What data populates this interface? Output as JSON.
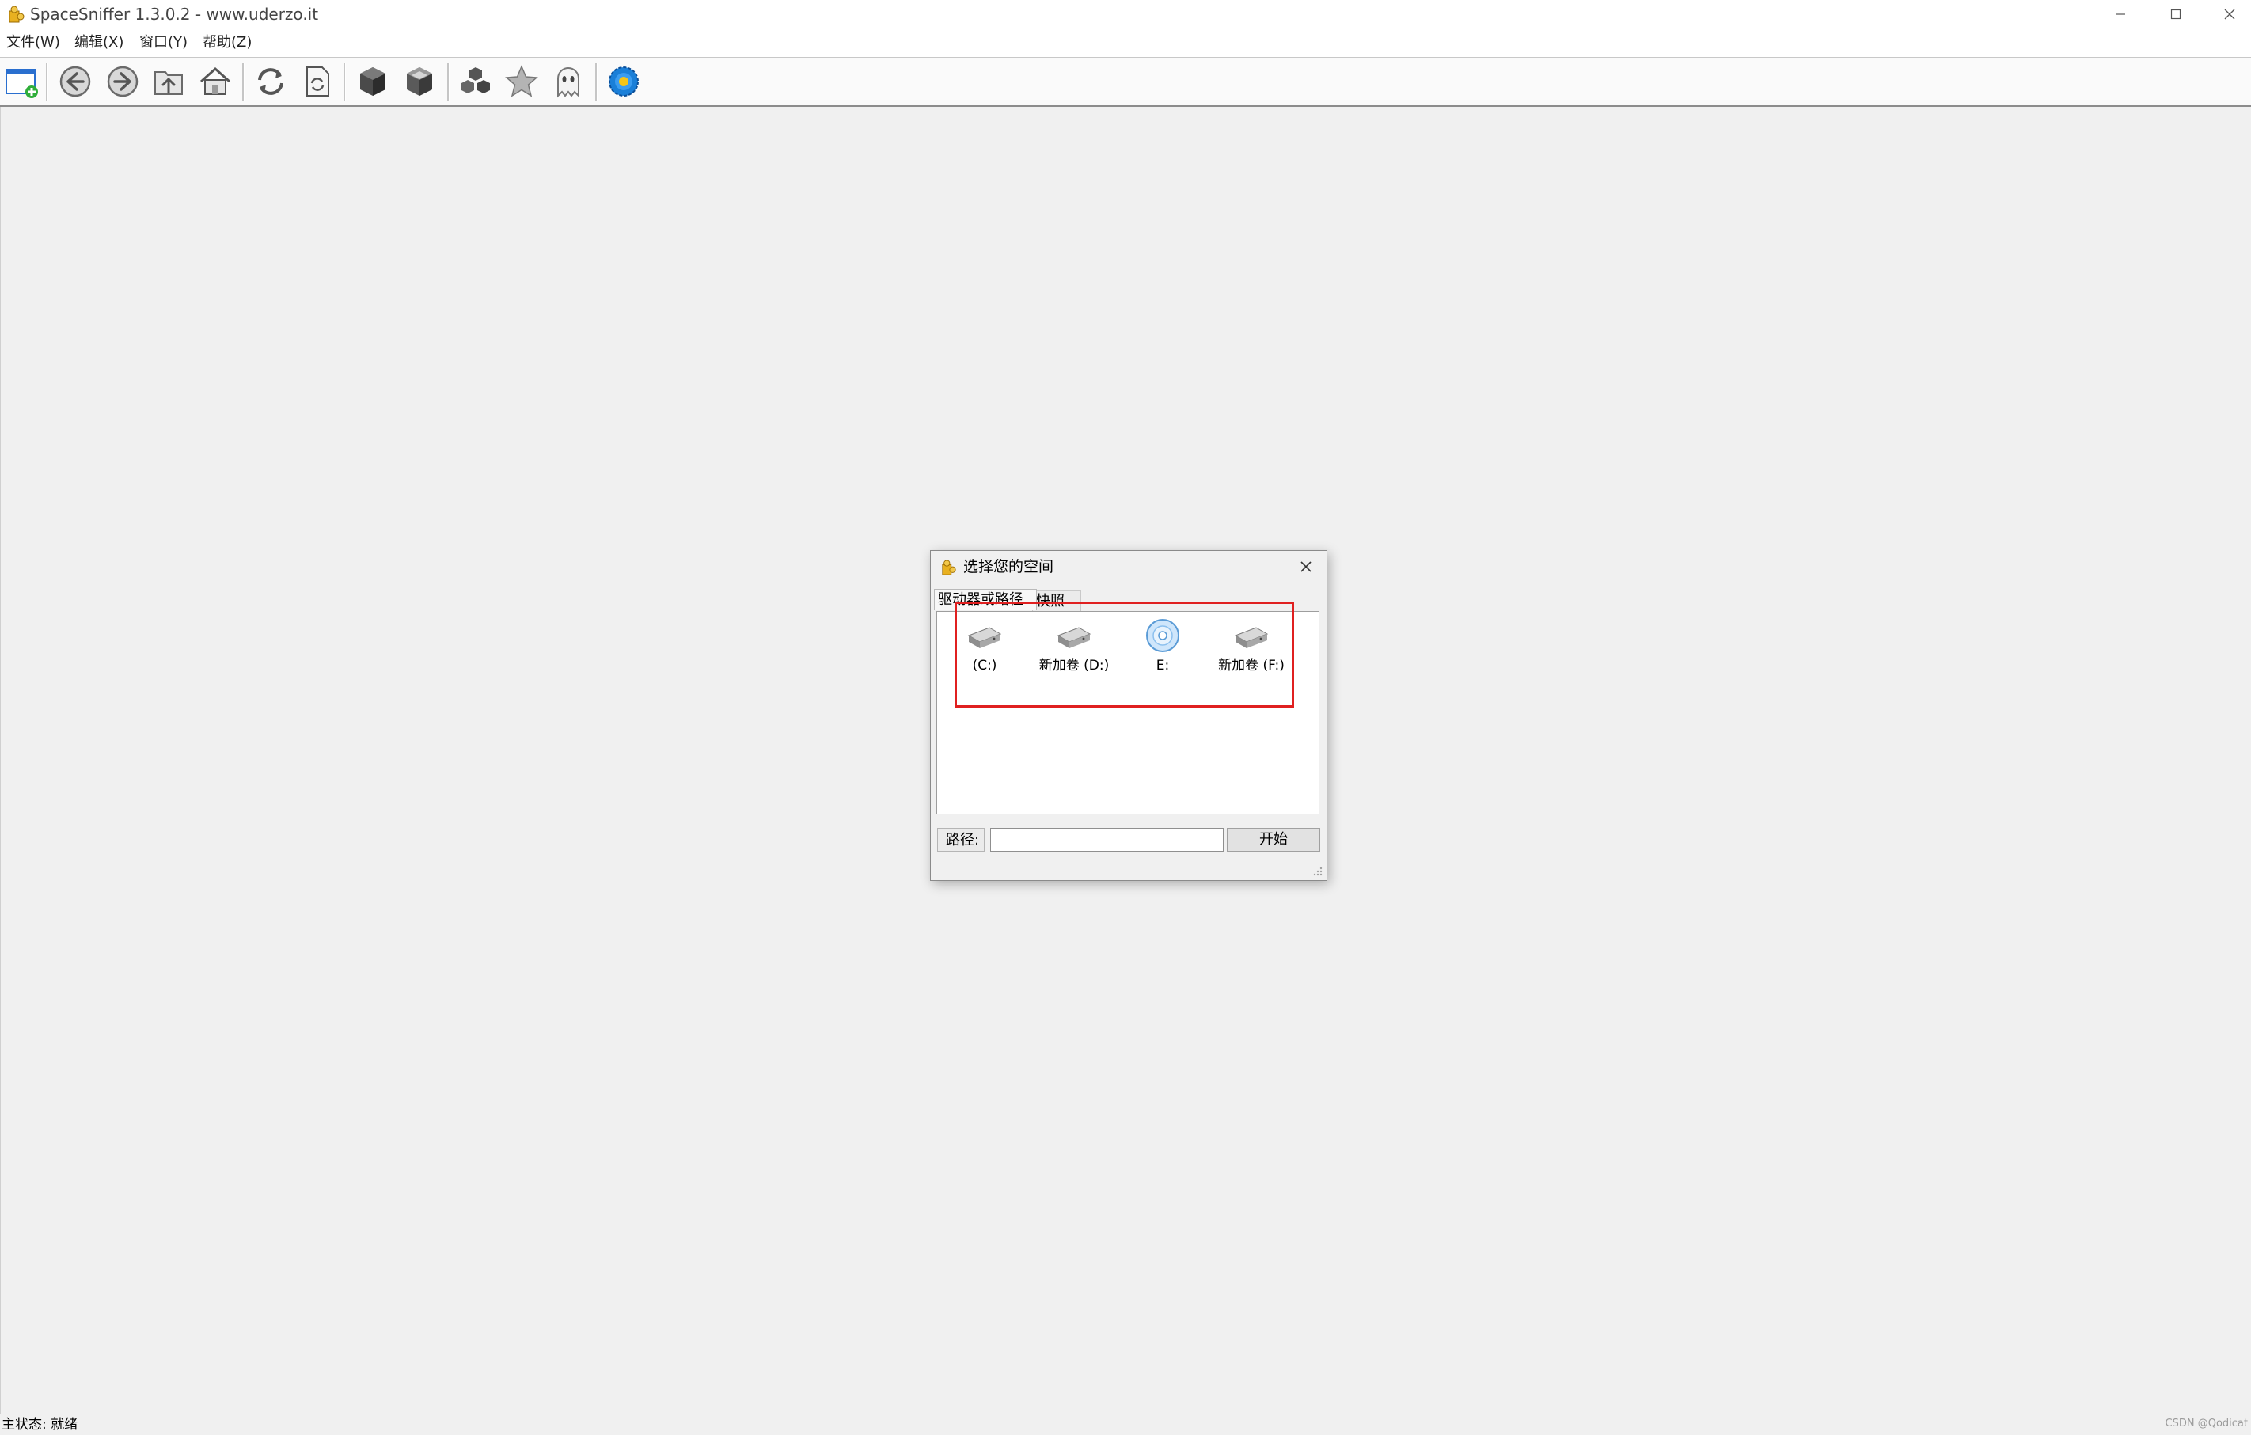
{
  "window": {
    "title": "SpaceSniffer 1.3.0.2 - www.uderzo.it",
    "app_icon": "puzzle-icon",
    "controls": [
      "minimize-icon",
      "maximize-icon",
      "close-icon"
    ]
  },
  "menu": {
    "items": [
      {
        "label": "文件(W)"
      },
      {
        "label": "编辑(X)"
      },
      {
        "label": "窗口(Y)"
      },
      {
        "label": "帮助(Z)"
      }
    ]
  },
  "toolbar": {
    "buttons": [
      {
        "icon": "new-window-icon"
      },
      {
        "icon": "back-arrow-icon"
      },
      {
        "icon": "forward-arrow-icon"
      },
      {
        "icon": "up-folder-icon"
      },
      {
        "icon": "home-icon"
      },
      {
        "icon": "refresh-icon"
      },
      {
        "icon": "refresh-document-icon"
      },
      {
        "icon": "cube-dark-icon"
      },
      {
        "icon": "cube-open-icon"
      },
      {
        "icon": "cubes-icon"
      },
      {
        "icon": "star-icon"
      },
      {
        "icon": "ghost-icon"
      },
      {
        "icon": "gear-badge-icon"
      }
    ]
  },
  "dialog": {
    "title": "选择您的空间",
    "icon": "puzzle-icon",
    "tabs": [
      {
        "label": "驱动器或路径",
        "active": true
      },
      {
        "label": "快照",
        "active": false
      }
    ],
    "drives": [
      {
        "label": "(C:)",
        "icon": "hard-drive-icon"
      },
      {
        "label": "新加卷 (D:)",
        "icon": "hard-drive-icon"
      },
      {
        "label": "E:",
        "icon": "cd-drive-icon"
      },
      {
        "label": "新加卷 (F:)",
        "icon": "hard-drive-icon"
      }
    ],
    "path_label": "路径:",
    "path_value": "",
    "start_label": "开始"
  },
  "statusbar": {
    "text": "主状态: 就绪",
    "watermark": "CSDN @Qodicat"
  },
  "colors": {
    "highlight": "#e02020",
    "background": "#f0f0f0",
    "gear_badge": "#1a7fd8"
  }
}
